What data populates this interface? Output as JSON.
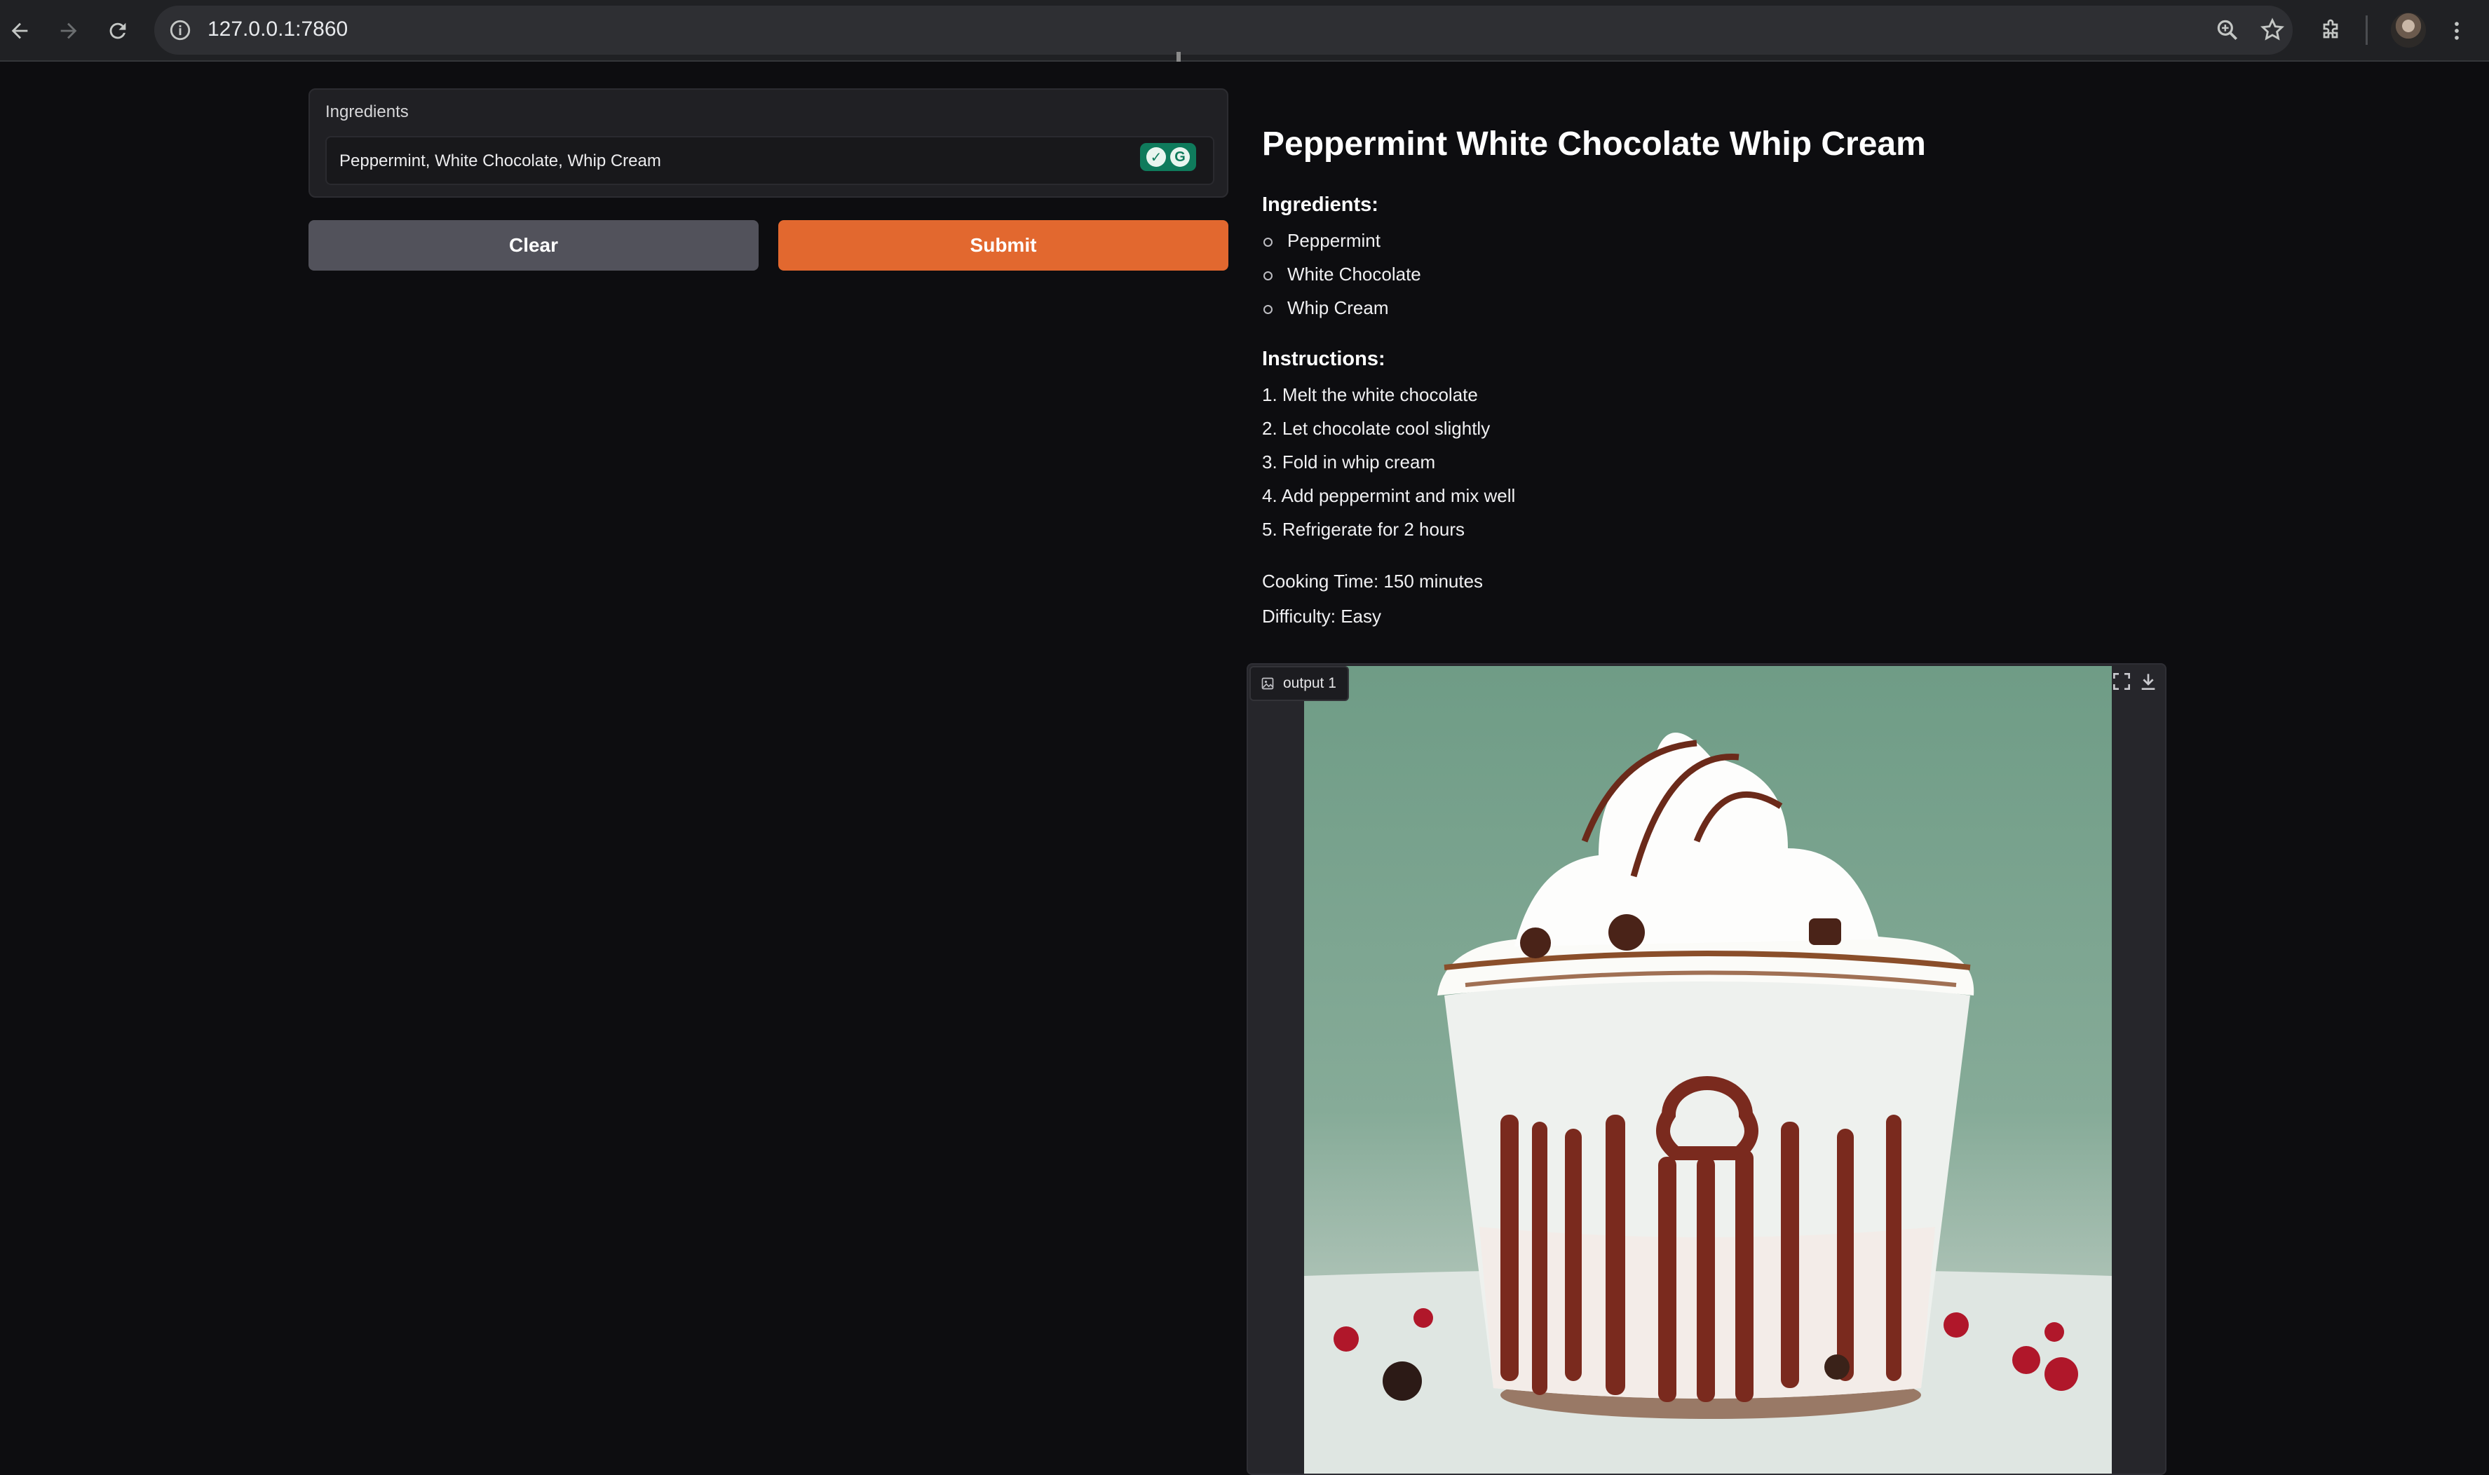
{
  "browser": {
    "url": "127.0.0.1:7860"
  },
  "ingredients_input": {
    "label": "Ingredients",
    "value": "Peppermint, White Chocolate, Whip Cream"
  },
  "buttons": {
    "clear": "Clear",
    "submit": "Submit"
  },
  "recipe": {
    "title": "Peppermint White Chocolate Whip Cream",
    "ingredients_heading": "Ingredients:",
    "ingredients": [
      "Peppermint",
      "White Chocolate",
      "Whip Cream"
    ],
    "instructions_heading": "Instructions:",
    "instructions": [
      "1. Melt the white chocolate",
      "2. Let chocolate cool slightly",
      "3. Fold in whip cream",
      "4. Add peppermint and mix well",
      "5. Refrigerate for 2 hours"
    ],
    "cooking_time": "Cooking Time: 150 minutes",
    "difficulty": "Difficulty: Easy"
  },
  "output_image": {
    "label": "output 1"
  },
  "colors": {
    "submit_accent": "#e2682f",
    "clear_button": "#52525b",
    "background": "#0d0d10"
  }
}
